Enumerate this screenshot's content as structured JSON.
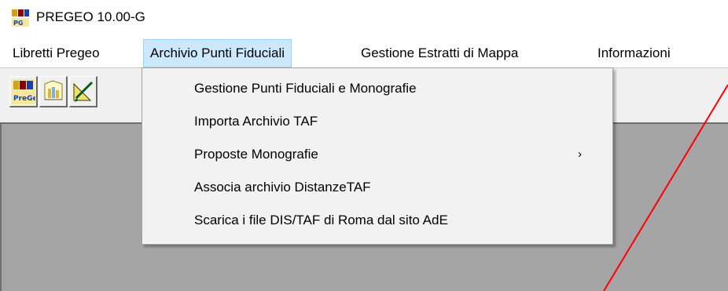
{
  "window": {
    "title": "PREGEO 10.00-G",
    "icon": "pregeo-app-icon"
  },
  "menubar": {
    "items": [
      {
        "label": "Libretti Pregeo"
      },
      {
        "label": "Archivio Punti Fiduciali",
        "state": "open"
      },
      {
        "label": "Gestione Estratti di Mappa"
      },
      {
        "label": "Informazioni"
      }
    ]
  },
  "toolbar": {
    "buttons": [
      {
        "icon": "pregeo-logo-icon",
        "logo_text": "PreGeo"
      },
      {
        "icon": "map-document-icon"
      },
      {
        "icon": "draw-triangle-icon"
      }
    ]
  },
  "dropdown": {
    "items": [
      {
        "label": "Gestione Punti Fiduciali e Monografie"
      },
      {
        "label": "Importa Archivio TAF"
      },
      {
        "label": "Proposte Monografie",
        "submenu_icon": "chevron-right-icon"
      },
      {
        "label": "Associa archivio DistanzeTAF"
      },
      {
        "label": "Scarica i file DIS/TAF di Roma dal sito AdE"
      }
    ]
  },
  "colors": {
    "menu_highlight": "#cce8ff",
    "annotation_line": "#ff0000",
    "mdi_background": "#a5a5a5"
  }
}
